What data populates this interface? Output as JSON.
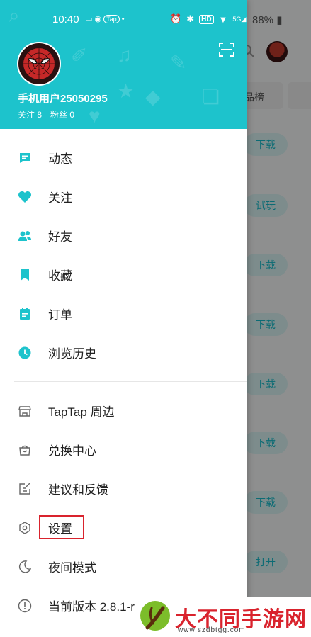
{
  "status_bar": {
    "time": "10:40",
    "app_badge": "Tap",
    "hd_label": "HD",
    "network_label": "5G",
    "battery": "88%"
  },
  "profile": {
    "username": "手机用户25050295",
    "following": "关注 8",
    "followers": "粉丝 0"
  },
  "menu_primary": [
    {
      "label": "动态",
      "icon": "message-icon"
    },
    {
      "label": "关注",
      "icon": "heart-icon"
    },
    {
      "label": "好友",
      "icon": "friends-icon"
    },
    {
      "label": "收藏",
      "icon": "bookmark-icon"
    },
    {
      "label": "订单",
      "icon": "clipboard-icon"
    },
    {
      "label": "浏览历史",
      "icon": "clock-icon"
    }
  ],
  "menu_secondary": [
    {
      "label": "TapTap 周边",
      "icon": "store-icon"
    },
    {
      "label": "兑换中心",
      "icon": "gift-bag-icon"
    },
    {
      "label": "建议和反馈",
      "icon": "edit-icon"
    },
    {
      "label": "设置",
      "icon": "settings-icon"
    },
    {
      "label": "夜间模式",
      "icon": "moon-icon"
    },
    {
      "label": "当前版本 2.8.1-r",
      "icon": "info-icon"
    }
  ],
  "background_app": {
    "tab_label": "品榜",
    "buttons": [
      "下载",
      "试玩",
      "下载",
      "下载",
      "下载",
      "下载",
      "下载",
      "打开"
    ]
  },
  "watermark": {
    "title": "大不同手游网",
    "url": "www.szdbtgg.com"
  },
  "colors": {
    "accent": "#1dc3cc",
    "highlight_box": "#d9232d"
  }
}
